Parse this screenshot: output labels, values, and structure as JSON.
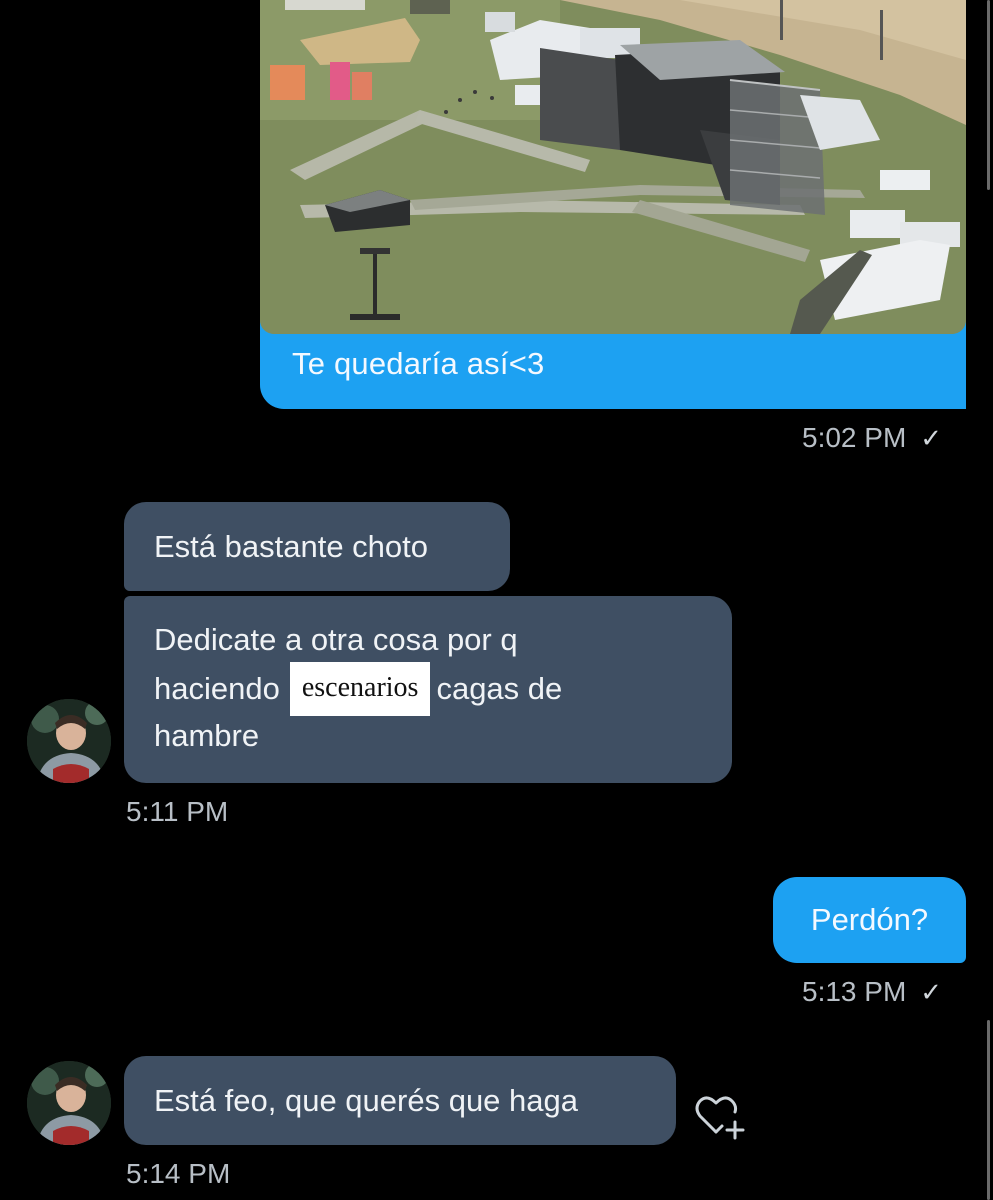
{
  "conversation": {
    "messages": [
      {
        "direction": "sent",
        "type": "media",
        "image_alt": "aerial-festival-stage-photo",
        "caption": "Te quedaría así<3",
        "time": "5:02 PM",
        "status_icon": "check-icon"
      },
      {
        "direction": "received",
        "type": "text",
        "text": "Está bastante choto"
      },
      {
        "direction": "received",
        "type": "text",
        "lines": [
          "Dedicate a otra cosa por q",
          "haciendo",
          "cagas de",
          "hambre"
        ],
        "redaction_label": "escenarios",
        "time": "5:11 PM"
      },
      {
        "direction": "sent",
        "type": "text",
        "text": "Perdón?",
        "time": "5:13 PM",
        "status_icon": "check-icon"
      },
      {
        "direction": "received",
        "type": "text",
        "text": "Está feo, que querés que haga",
        "time": "5:14 PM",
        "reaction_action_icon": "heart-plus-icon"
      }
    ]
  },
  "colors": {
    "background": "#000000",
    "sent_bubble": "#1da1f2",
    "received_bubble": "#3f4f63",
    "timestamp": "#b8bfc6"
  },
  "glyphs": {
    "check": "✓"
  }
}
